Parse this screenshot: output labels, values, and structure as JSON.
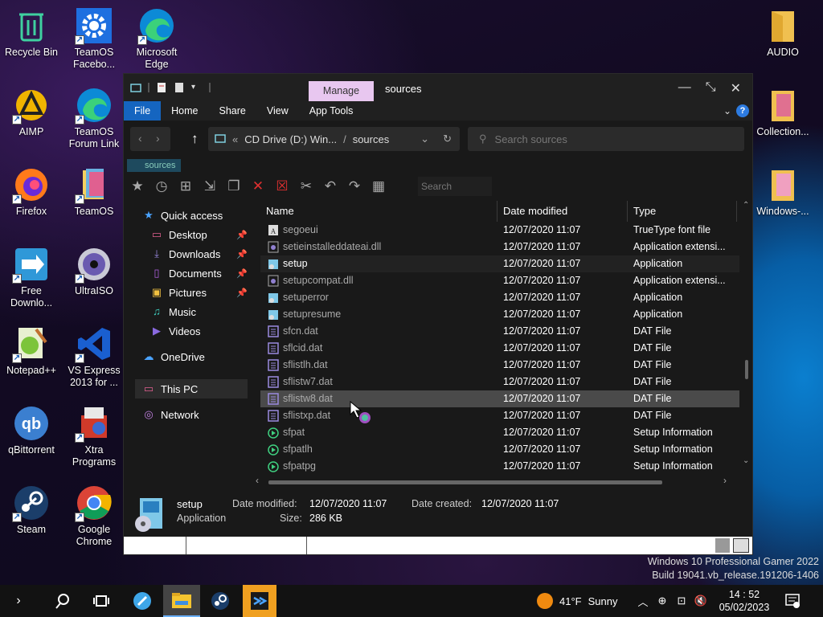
{
  "desktop": {
    "left_icons": [
      {
        "label": "Recycle Bin",
        "icon": "recycle-bin-icon"
      },
      {
        "label": "TeamOS Facebo...",
        "icon": "gear-icon"
      },
      {
        "label": "Microsoft Edge",
        "icon": "edge-icon"
      },
      {
        "label": "AIMP",
        "icon": "aimp-icon"
      },
      {
        "label": "TeamOS Forum Link",
        "icon": "edge-icon"
      },
      {
        "label": "Firefox",
        "icon": "firefox-icon"
      },
      {
        "label": "TeamOS",
        "icon": "folder-icon"
      },
      {
        "label": "Free Downlo...",
        "icon": "download-icon"
      },
      {
        "label": "UltraISO",
        "icon": "disc-icon"
      },
      {
        "label": "Notepad++",
        "icon": "notepad-icon"
      },
      {
        "label": "VS Express 2013 for ...",
        "icon": "visual-studio-icon"
      },
      {
        "label": "qBittorrent",
        "icon": "qbittorrent-icon"
      },
      {
        "label": "Xtra Programs",
        "icon": "xtra-icon"
      },
      {
        "label": "Steam",
        "icon": "steam-icon"
      },
      {
        "label": "Google Chrome",
        "icon": "chrome-icon"
      }
    ],
    "right_icons": [
      {
        "label": "AUDIO",
        "icon": "folder-icon"
      },
      {
        "label": "Collection...",
        "icon": "folder-icon"
      },
      {
        "label": "Windows-...",
        "icon": "folder-icon"
      }
    ],
    "watermark_line1": "Windows 10 Professional Gamer 2022",
    "watermark_line2": "Build 19041.vb_release.191206-1406"
  },
  "explorer": {
    "manage_tab": "Manage",
    "title": "sources",
    "ribbon_tabs": [
      "File",
      "Home",
      "Share",
      "View",
      "App Tools"
    ],
    "address": {
      "prefix": "«",
      "drive": "CD Drive (D:) Win...",
      "sep": "/",
      "folder": "sources"
    },
    "search_placeholder": "Search sources",
    "crumb": "sources",
    "toolbar_search": "Search",
    "nav": {
      "quick_access": "Quick access",
      "items": [
        "Desktop",
        "Downloads",
        "Documents",
        "Pictures",
        "Music",
        "Videos"
      ],
      "onedrive": "OneDrive",
      "thispc": "This PC",
      "network": "Network"
    },
    "columns": {
      "name": "Name",
      "date": "Date modified",
      "type": "Type"
    },
    "files": [
      {
        "name": "segoeui",
        "date": "12/07/2020 11:07",
        "type": "TrueType font file",
        "icon": "font-icon"
      },
      {
        "name": "setieinstalleddateai.dll",
        "date": "12/07/2020 11:07",
        "type": "Application extensi...",
        "icon": "dll-icon"
      },
      {
        "name": "setup",
        "date": "12/07/2020 11:07",
        "type": "Application",
        "icon": "setup-icon"
      },
      {
        "name": "setupcompat.dll",
        "date": "12/07/2020 11:07",
        "type": "Application extensi...",
        "icon": "dll-icon"
      },
      {
        "name": "setuperror",
        "date": "12/07/2020 11:07",
        "type": "Application",
        "icon": "setup-icon"
      },
      {
        "name": "setupresume",
        "date": "12/07/2020 11:07",
        "type": "Application",
        "icon": "setup-icon"
      },
      {
        "name": "sfcn.dat",
        "date": "12/07/2020 11:07",
        "type": "DAT File",
        "icon": "dat-icon"
      },
      {
        "name": "sflcid.dat",
        "date": "12/07/2020 11:07",
        "type": "DAT File",
        "icon": "dat-icon"
      },
      {
        "name": "sflistlh.dat",
        "date": "12/07/2020 11:07",
        "type": "DAT File",
        "icon": "dat-icon"
      },
      {
        "name": "sflistw7.dat",
        "date": "12/07/2020 11:07",
        "type": "DAT File",
        "icon": "dat-icon"
      },
      {
        "name": "sflistw8.dat",
        "date": "12/07/2020 11:07",
        "type": "DAT File",
        "icon": "dat-icon"
      },
      {
        "name": "sflistxp.dat",
        "date": "12/07/2020 11:07",
        "type": "DAT File",
        "icon": "dat-icon"
      },
      {
        "name": "sfpat",
        "date": "12/07/2020 11:07",
        "type": "Setup Information",
        "icon": "inf-icon"
      },
      {
        "name": "sfpatlh",
        "date": "12/07/2020 11:07",
        "type": "Setup Information",
        "icon": "inf-icon"
      },
      {
        "name": "sfpatpg",
        "date": "12/07/2020 11:07",
        "type": "Setup Information",
        "icon": "inf-icon"
      }
    ],
    "details": {
      "name": "setup",
      "kind": "Application",
      "modified_label": "Date modified:",
      "modified": "12/07/2020 11:07",
      "created_label": "Date created:",
      "created": "12/07/2020 11:07",
      "size_label": "Size:",
      "size": "286 KB"
    }
  },
  "taskbar": {
    "weather_temp": "41°F",
    "weather_text": "Sunny",
    "time": "14 : 52",
    "date": "05/02/2023"
  }
}
